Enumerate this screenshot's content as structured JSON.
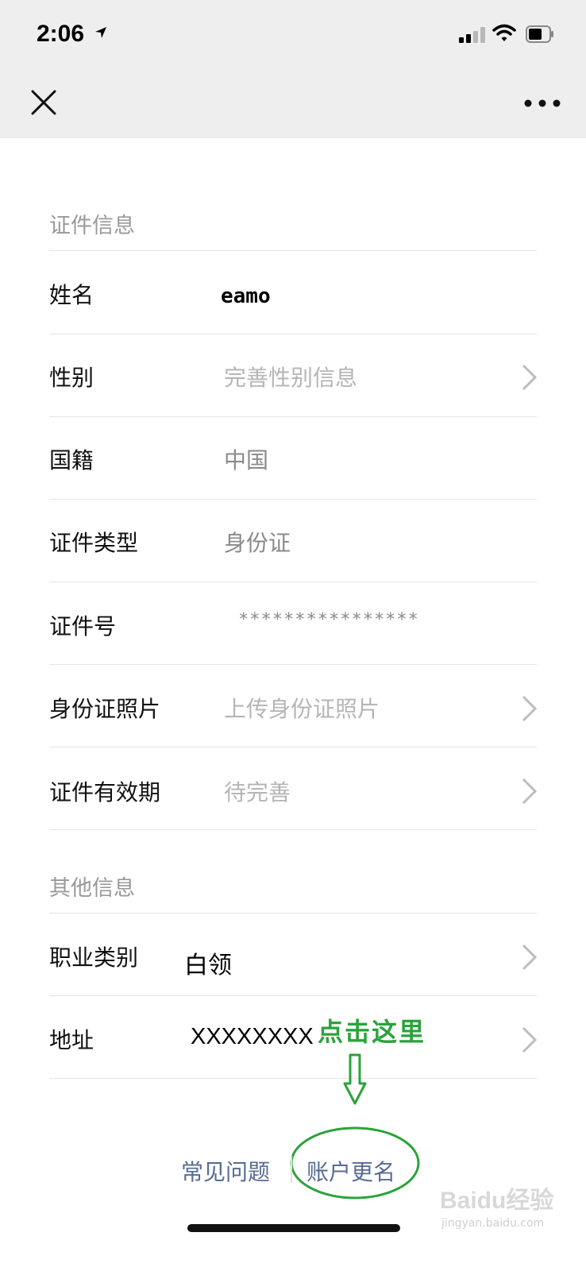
{
  "status": {
    "time": "2:06"
  },
  "nav": {
    "close_icon": "close-icon",
    "more_icon": "more-icon"
  },
  "sections": {
    "id_info": "证件信息",
    "other_info": "其他信息"
  },
  "rows": {
    "name": {
      "label": "姓名",
      "value": "eamo"
    },
    "gender": {
      "label": "性别",
      "value": "完善性别信息"
    },
    "nationality": {
      "label": "国籍",
      "value": "中国"
    },
    "id_type": {
      "label": "证件类型",
      "value": "身份证"
    },
    "id_number": {
      "label": "证件号",
      "value": "****************"
    },
    "id_photo": {
      "label": "身份证照片",
      "value": "上传身份证照片"
    },
    "id_validity": {
      "label": "证件有效期",
      "value": "待完善"
    },
    "occupation": {
      "label": "职业类别",
      "value": "白领"
    },
    "address": {
      "label": "地址",
      "value": "XXXXXXXX"
    }
  },
  "footer": {
    "faq": "常见问题",
    "rename": "账户更名"
  },
  "annotation": {
    "text": "点击这里",
    "color": "#2aa33a"
  },
  "watermark": {
    "main": "Baidu经验",
    "sub": "jingyan.baidu.com"
  }
}
